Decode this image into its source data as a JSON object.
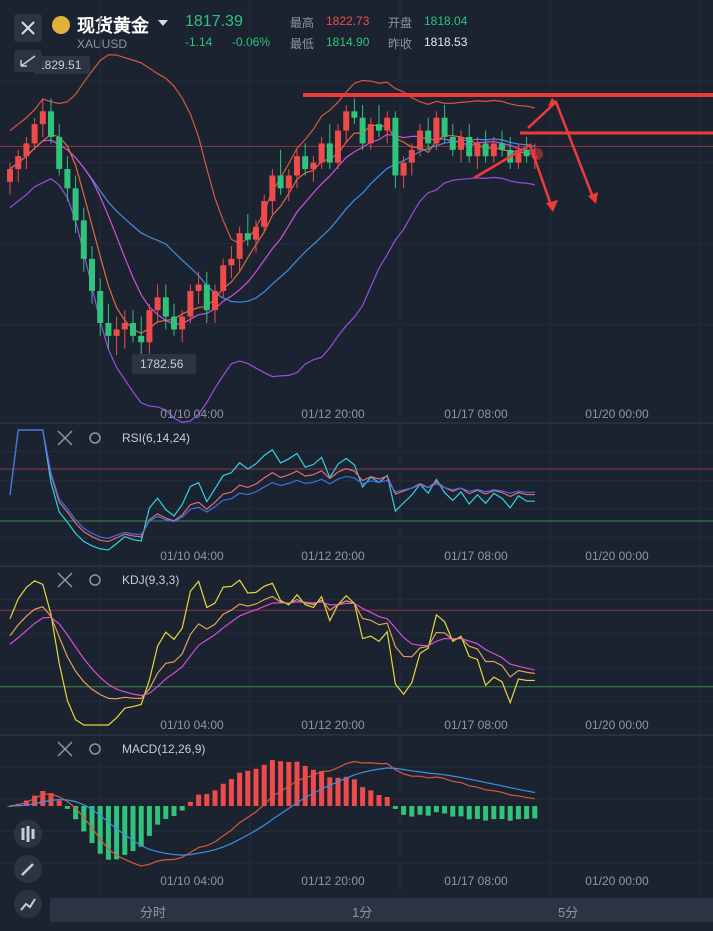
{
  "header": {
    "title": "现货黄金",
    "symbol": "XAUUSD",
    "price": "1817.39",
    "change": "-1.14",
    "change_pct": "-0.06%",
    "high_label": "最高",
    "high": "1822.73",
    "open_label": "开盘",
    "open": "1818.04",
    "low_label": "最低",
    "low": "1814.90",
    "prev_close_label": "昨收",
    "prev_close": "1818.53"
  },
  "colors": {
    "bg": "#1b2330",
    "up": "#ef4b4b",
    "down": "#31c27c",
    "grid": "#2a3442"
  },
  "main": {
    "max_label": "1829.51",
    "min_label": "1782.56"
  },
  "time_labels": [
    "01/10 04:00",
    "01/12 20:00",
    "01/17 08:00",
    "01/20 00:00"
  ],
  "indicators": {
    "rsi": "RSI(6,14,24)",
    "kdj": "KDJ(9,3,3)",
    "macd": "MACD(12,26,9)"
  },
  "tabs": [
    "分时",
    "1分",
    "5分"
  ],
  "chart_data": [
    {
      "type": "candlestick",
      "symbol": "XAUUSD",
      "ylim": [
        1779,
        1832
      ],
      "x": [
        "01/10 04:00",
        "01/12 20:00",
        "01/17 08:00",
        "01/20 00:00"
      ],
      "candles": [
        [
          1813,
          1816,
          1811,
          1815
        ],
        [
          1815,
          1818,
          1813,
          1817
        ],
        [
          1817,
          1820,
          1815,
          1819
        ],
        [
          1819,
          1823,
          1818,
          1822
        ],
        [
          1822,
          1826,
          1820,
          1824
        ],
        [
          1824,
          1826,
          1819,
          1820
        ],
        [
          1820,
          1822,
          1814,
          1815
        ],
        [
          1815,
          1817,
          1810,
          1812
        ],
        [
          1812,
          1814,
          1805,
          1807
        ],
        [
          1807,
          1809,
          1799,
          1801
        ],
        [
          1801,
          1803,
          1794,
          1796
        ],
        [
          1796,
          1798,
          1789,
          1791
        ],
        [
          1791,
          1794,
          1787,
          1789
        ],
        [
          1789,
          1792,
          1786,
          1790
        ],
        [
          1790,
          1793,
          1787,
          1791
        ],
        [
          1791,
          1793,
          1788,
          1789
        ],
        [
          1789,
          1792,
          1785,
          1788
        ],
        [
          1788,
          1794,
          1786,
          1793
        ],
        [
          1793,
          1797,
          1791,
          1795
        ],
        [
          1795,
          1797,
          1790,
          1792
        ],
        [
          1792,
          1794,
          1789,
          1790
        ],
        [
          1790,
          1793,
          1788,
          1792
        ],
        [
          1792,
          1797,
          1791,
          1796
        ],
        [
          1796,
          1799,
          1794,
          1797
        ],
        [
          1797,
          1799,
          1791,
          1793
        ],
        [
          1793,
          1797,
          1791,
          1796
        ],
        [
          1796,
          1801,
          1795,
          1800
        ],
        [
          1800,
          1803,
          1798,
          1801
        ],
        [
          1801,
          1806,
          1799,
          1805
        ],
        [
          1805,
          1808,
          1803,
          1804
        ],
        [
          1804,
          1807,
          1802,
          1806
        ],
        [
          1806,
          1811,
          1805,
          1810
        ],
        [
          1810,
          1815,
          1808,
          1814
        ],
        [
          1814,
          1818,
          1811,
          1812
        ],
        [
          1812,
          1815,
          1810,
          1814
        ],
        [
          1814,
          1818,
          1812,
          1817
        ],
        [
          1817,
          1819,
          1814,
          1815
        ],
        [
          1815,
          1817,
          1813,
          1816
        ],
        [
          1816,
          1820,
          1815,
          1819
        ],
        [
          1819,
          1822,
          1815,
          1816
        ],
        [
          1816,
          1822,
          1815,
          1821
        ],
        [
          1821,
          1825,
          1819,
          1824
        ],
        [
          1824,
          1826,
          1822,
          1823
        ],
        [
          1823,
          1825,
          1818,
          1819
        ],
        [
          1819,
          1823,
          1818,
          1822
        ],
        [
          1822,
          1825,
          1820,
          1821
        ],
        [
          1821,
          1824,
          1819,
          1823
        ],
        [
          1823,
          1824,
          1812,
          1814
        ],
        [
          1814,
          1817,
          1812,
          1816
        ],
        [
          1816,
          1819,
          1814,
          1818
        ],
        [
          1818,
          1822,
          1817,
          1821
        ],
        [
          1821,
          1823,
          1818,
          1819
        ],
        [
          1819,
          1824,
          1818,
          1823
        ],
        [
          1823,
          1825,
          1819,
          1820
        ],
        [
          1820,
          1822,
          1817,
          1818
        ],
        [
          1818,
          1821,
          1816,
          1820
        ],
        [
          1820,
          1822,
          1816,
          1817
        ],
        [
          1817,
          1820,
          1815,
          1819
        ],
        [
          1819,
          1821,
          1816,
          1817
        ],
        [
          1817,
          1820,
          1816,
          1819
        ],
        [
          1819,
          1821,
          1817,
          1818
        ],
        [
          1818,
          1820,
          1815,
          1816
        ],
        [
          1816,
          1819,
          1815,
          1818
        ],
        [
          1818,
          1820,
          1816,
          1817
        ],
        [
          1817,
          1819,
          1815,
          1817
        ]
      ]
    },
    {
      "type": "line",
      "name": "RSI(6,14,24)",
      "ylim": [
        0,
        100
      ]
    },
    {
      "type": "line",
      "name": "KDJ(9,3,3)",
      "ylim": [
        -10,
        110
      ]
    },
    {
      "type": "bar",
      "name": "MACD(12,26,9)"
    }
  ]
}
